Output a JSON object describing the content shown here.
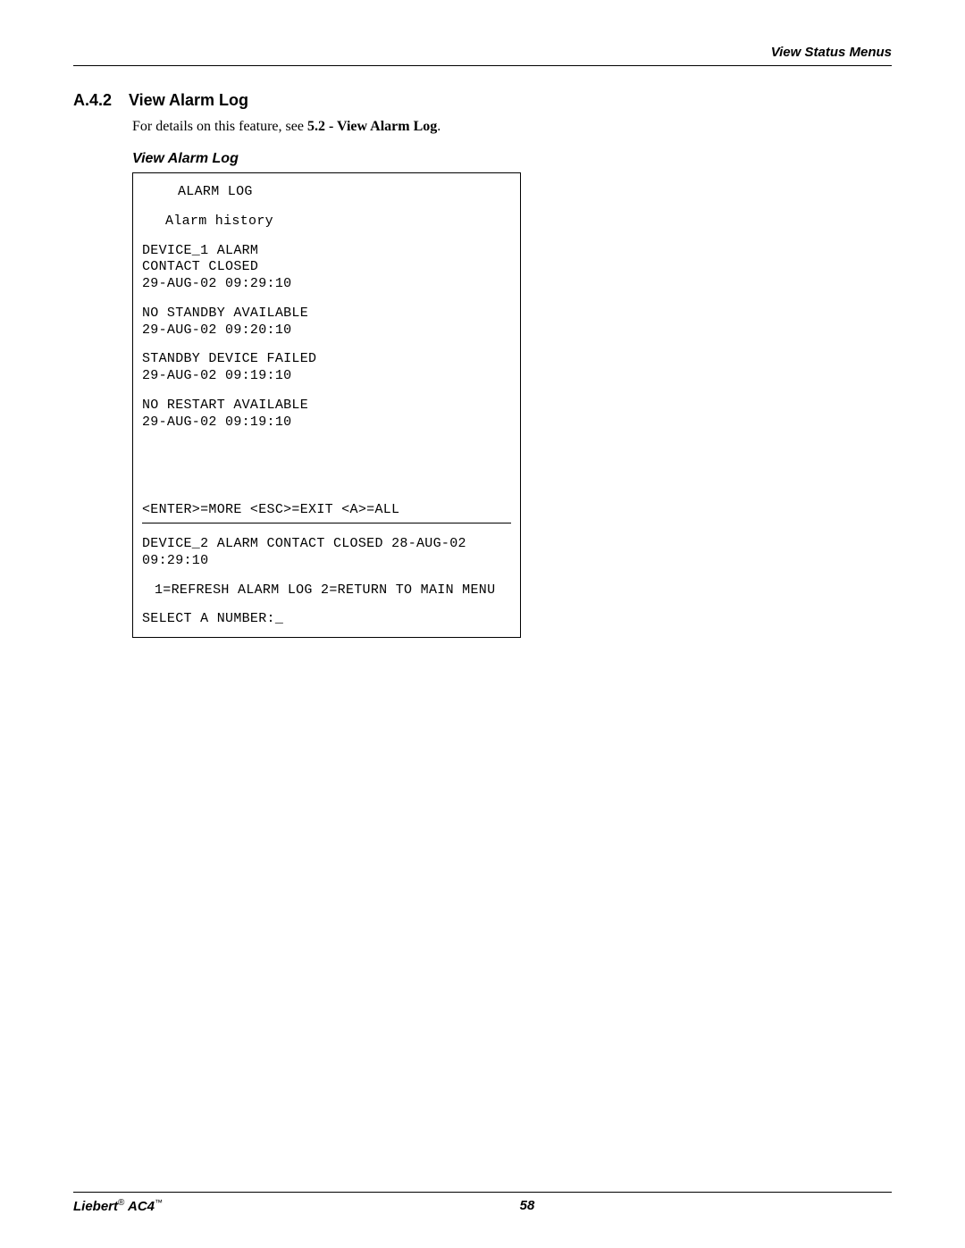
{
  "header": {
    "breadcrumb": "View Status Menus"
  },
  "section": {
    "number": "A.4.2",
    "title": "View Alarm Log",
    "desc_prefix": "For details on this feature, see ",
    "desc_ref": "5.2 - View Alarm Log",
    "desc_suffix": "."
  },
  "figure": {
    "title": "View Alarm Log"
  },
  "terminal": {
    "screen_title": "ALARM LOG",
    "screen_subtitle": "Alarm history",
    "entries_page1": [
      {
        "line1": "DEVICE_1 ALARM",
        "line2": "CONTACT CLOSED",
        "line3": "29-AUG-02   09:29:10"
      },
      {
        "line1": "NO STANDBY AVAILABLE",
        "line2": "29-AUG-02   09:20:10"
      },
      {
        "line1": "STANDBY DEVICE FAILED",
        "line2": "29-AUG-02   09:19:10"
      },
      {
        "line1": "NO RESTART AVAILABLE",
        "line2": "29-AUG-02   09:19:10"
      }
    ],
    "nav_hint": "<ENTER>=MORE <ESC>=EXIT <A>=ALL",
    "entries_page2": [
      {
        "line1": "DEVICE_2 ALARM",
        "line2": "CONTACT CLOSED",
        "line3": "28-AUG-02   09:29:10"
      }
    ],
    "menu_options": [
      "1=REFRESH ALARM LOG",
      "2=RETURN TO MAIN MENU"
    ],
    "prompt": "SELECT A NUMBER:_"
  },
  "footer": {
    "brand_prefix": "Liebert",
    "brand_reg": "®",
    "product": " AC4",
    "product_tm": "™",
    "page_number": "58"
  }
}
